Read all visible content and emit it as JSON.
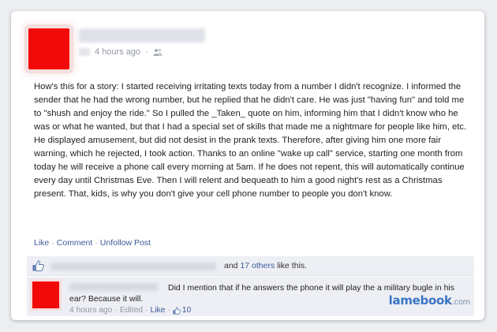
{
  "post": {
    "timestamp": "4 hours ago",
    "privacy_icon": "friends-icon",
    "text": "How's this for a story: I started receiving irritating texts today from a number I didn't recognize. I informed the sender that he had the wrong number, but he replied that he didn't care. He was just \"having fun\" and told me to \"shush and enjoy the ride.\" So I pulled the _Taken_ quote on him, informing him that I didn't know who he was or what he wanted, but that I had a special set of skills that made me a nightmare for people like him, etc. He displayed amusement, but did not desist in the prank texts. Therefore, after giving him one more fair warning, which he rejected, I took action. Thanks to an online \"wake up call\" service, starting one month from today he will receive a phone call every morning at 5am. If he does not repent, this will automatically continue every day until Christmas Eve. Then I will relent and bequeath to him a good night's rest as a Christmas present. That, kids, is why you don't give your cell phone number to people you don't know."
  },
  "actions": {
    "like": "Like",
    "comment": "Comment",
    "unfollow": "Unfollow Post",
    "separator": "·"
  },
  "likes": {
    "prefix": "and ",
    "others_link": "17 others",
    "suffix": " like this."
  },
  "comment": {
    "text": "Did I mention that if he answers the phone it will play the a military bugle in his ear? Because it will.",
    "timestamp": "4 hours ago",
    "edited": "Edited",
    "like": "Like",
    "like_count": "10"
  },
  "watermark": {
    "brand": "lamebook",
    "tld": ".com"
  },
  "colors": {
    "link": "#3b5998",
    "muted": "#9197a3",
    "avatar": "#f20a0a"
  }
}
